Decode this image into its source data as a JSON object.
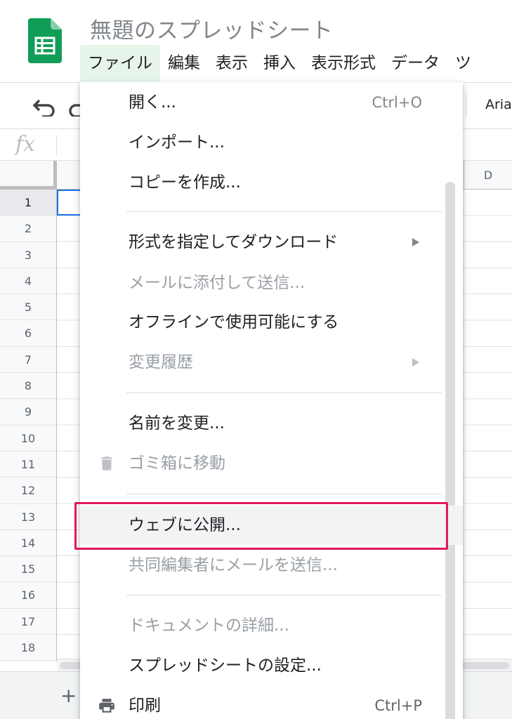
{
  "app": {
    "title": "無題のスプレッドシート",
    "logo_icon": "google-sheets-logo-icon",
    "brand_color": "#0f9d58"
  },
  "menubar": {
    "items": [
      {
        "label": "ファイル",
        "active": true
      },
      {
        "label": "編集"
      },
      {
        "label": "表示"
      },
      {
        "label": "挿入"
      },
      {
        "label": "表示形式"
      },
      {
        "label": "データ"
      },
      {
        "label": "ツ"
      }
    ]
  },
  "toolbar": {
    "undo_icon": "undo-icon",
    "redo_icon": "redo-icon",
    "font": "Aria"
  },
  "formula_bar": {
    "fx_label": "fx"
  },
  "grid": {
    "column_headers": [
      "D"
    ],
    "row_numbers": [
      "1",
      "2",
      "3",
      "4",
      "5",
      "6",
      "7",
      "8",
      "9",
      "10",
      "11",
      "12",
      "13",
      "14",
      "15",
      "16",
      "17",
      "18"
    ],
    "selected_row": "1"
  },
  "sheet_bar": {
    "add_label": "+"
  },
  "file_menu": {
    "items": [
      {
        "label": "開く...",
        "shortcut": "Ctrl+O",
        "enabled": true
      },
      {
        "label": "インポート...",
        "enabled": true
      },
      {
        "label": "コピーを作成...",
        "enabled": true
      },
      {
        "label": "形式を指定してダウンロード",
        "submenu": true,
        "enabled": true
      },
      {
        "label": "メールに添付して送信...",
        "enabled": false
      },
      {
        "label": "オフラインで使用可能にする",
        "enabled": true
      },
      {
        "label": "変更履歴",
        "submenu": true,
        "enabled": false
      },
      {
        "label": "名前を変更...",
        "enabled": true
      },
      {
        "label": "ゴミ箱に移動",
        "icon": "trash-icon",
        "enabled": false
      },
      {
        "label": "ウェブに公開...",
        "enabled": true,
        "highlighted": true
      },
      {
        "label": "共同編集者にメールを送信...",
        "enabled": false
      },
      {
        "label": "ドキュメントの詳細...",
        "enabled": false
      },
      {
        "label": "スプレッドシートの設定...",
        "enabled": true
      },
      {
        "label": "印刷",
        "icon": "print-icon",
        "shortcut": "Ctrl+P",
        "enabled": true
      }
    ],
    "highlight_color": "#e0195a"
  }
}
